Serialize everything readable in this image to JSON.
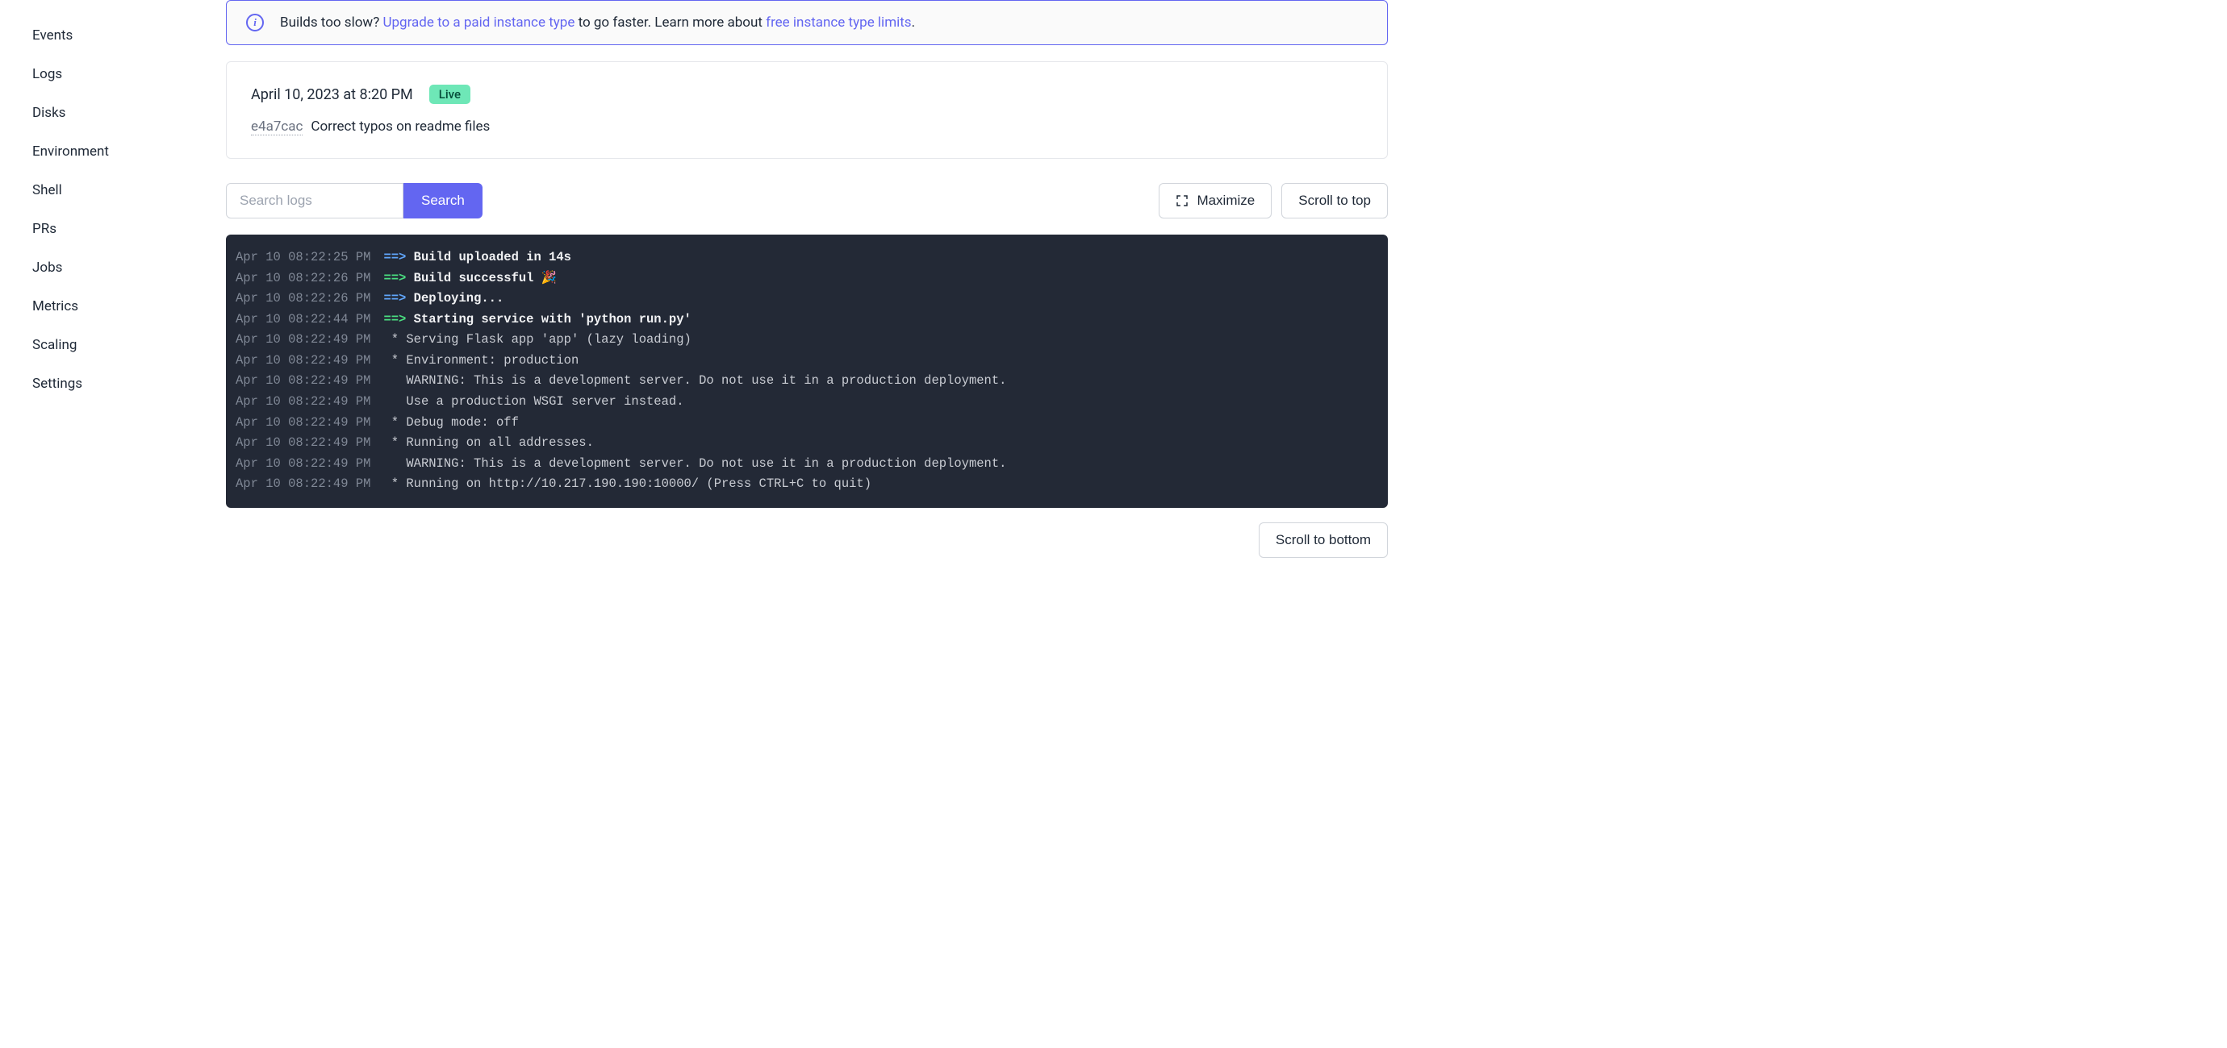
{
  "sidebar": {
    "items": [
      {
        "label": "Events"
      },
      {
        "label": "Logs"
      },
      {
        "label": "Disks"
      },
      {
        "label": "Environment"
      },
      {
        "label": "Shell"
      },
      {
        "label": "PRs"
      },
      {
        "label": "Jobs"
      },
      {
        "label": "Metrics"
      },
      {
        "label": "Scaling"
      },
      {
        "label": "Settings"
      }
    ]
  },
  "banner": {
    "text_before": "Builds too slow? ",
    "link1": "Upgrade to a paid instance type",
    "text_mid": " to go faster. Learn more about ",
    "link2": "free instance type limits",
    "text_after": "."
  },
  "deploy": {
    "date": "April 10, 2023 at 8:20 PM",
    "badge": "Live",
    "commit_hash": "e4a7cac",
    "commit_msg": "Correct typos on readme files"
  },
  "search": {
    "placeholder": "Search logs",
    "button": "Search"
  },
  "buttons": {
    "maximize": "Maximize",
    "scroll_top": "Scroll to top",
    "scroll_bottom": "Scroll to bottom"
  },
  "logs": [
    {
      "ts": "Apr 10 08:22:25 PM",
      "arrow": "==>",
      "arrow_color": "blue",
      "bold": true,
      "msg": "Build uploaded in 14s"
    },
    {
      "ts": "Apr 10 08:22:26 PM",
      "arrow": "==>",
      "arrow_color": "green",
      "bold": true,
      "msg": "Build successful 🎉"
    },
    {
      "ts": "Apr 10 08:22:26 PM",
      "arrow": "==>",
      "arrow_color": "blue",
      "bold": true,
      "msg": "Deploying..."
    },
    {
      "ts": "Apr 10 08:22:44 PM",
      "arrow": "==>",
      "arrow_color": "green",
      "bold": true,
      "msg": "Starting service with 'python run.py'"
    },
    {
      "ts": "Apr 10 08:22:49 PM",
      "arrow": "",
      "arrow_color": "",
      "bold": false,
      "msg": " * Serving Flask app 'app' (lazy loading)"
    },
    {
      "ts": "Apr 10 08:22:49 PM",
      "arrow": "",
      "arrow_color": "",
      "bold": false,
      "msg": " * Environment: production"
    },
    {
      "ts": "Apr 10 08:22:49 PM",
      "arrow": "",
      "arrow_color": "",
      "bold": false,
      "msg": "   WARNING: This is a development server. Do not use it in a production deployment."
    },
    {
      "ts": "Apr 10 08:22:49 PM",
      "arrow": "",
      "arrow_color": "",
      "bold": false,
      "msg": "   Use a production WSGI server instead."
    },
    {
      "ts": "Apr 10 08:22:49 PM",
      "arrow": "",
      "arrow_color": "",
      "bold": false,
      "msg": " * Debug mode: off"
    },
    {
      "ts": "Apr 10 08:22:49 PM",
      "arrow": "",
      "arrow_color": "",
      "bold": false,
      "msg": " * Running on all addresses."
    },
    {
      "ts": "Apr 10 08:22:49 PM",
      "arrow": "",
      "arrow_color": "",
      "bold": false,
      "msg": "   WARNING: This is a development server. Do not use it in a production deployment."
    },
    {
      "ts": "Apr 10 08:22:49 PM",
      "arrow": "",
      "arrow_color": "",
      "bold": false,
      "msg": " * Running on http://10.217.190.190:10000/ (Press CTRL+C to quit)"
    }
  ]
}
